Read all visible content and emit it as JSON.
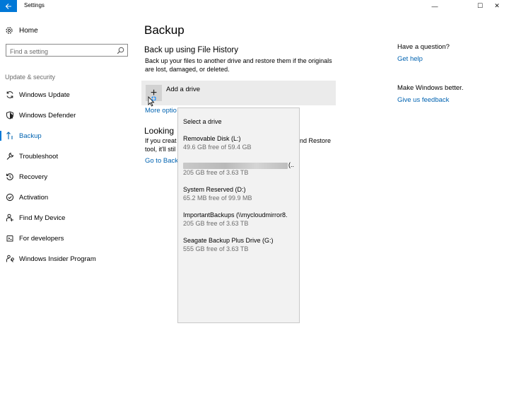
{
  "window": {
    "title": "Settings",
    "minimize_glyph": "—",
    "maximize_glyph": "☐",
    "close_glyph": "✕"
  },
  "sidebar": {
    "home_label": "Home",
    "search_placeholder": "Find a setting",
    "section_label": "Update & security",
    "items": [
      {
        "label": "Windows Update",
        "icon": "sync-icon"
      },
      {
        "label": "Windows Defender",
        "icon": "shield-icon"
      },
      {
        "label": "Backup",
        "icon": "backup-arrow-icon",
        "active": true
      },
      {
        "label": "Troubleshoot",
        "icon": "wrench-icon"
      },
      {
        "label": "Recovery",
        "icon": "history-icon"
      },
      {
        "label": "Activation",
        "icon": "check-circle-icon"
      },
      {
        "label": "Find My Device",
        "icon": "person-pin-icon"
      },
      {
        "label": "For developers",
        "icon": "developer-icon"
      },
      {
        "label": "Windows Insider Program",
        "icon": "insider-icon"
      }
    ]
  },
  "main": {
    "page_title": "Backup",
    "file_history": {
      "heading": "Back up using File History",
      "description": "Back up your files to another drive and restore them if the originals are lost, damaged, or deleted.",
      "add_drive_label": "Add a drive",
      "more_options": "More optio"
    },
    "looking": {
      "heading": "Looking",
      "line1": "If you creat",
      "line2": "tool, it'll stil",
      "line1_right": "nd Restore",
      "link": "Go to Backu"
    }
  },
  "right_panel": {
    "question_heading": "Have a question?",
    "get_help": "Get help",
    "better_heading": "Make Windows better.",
    "feedback": "Give us feedback"
  },
  "dropdown": {
    "title": "Select a drive",
    "drives": [
      {
        "name": "Removable Disk (L:)",
        "space": "49.6 GB free of 59.4 GB"
      },
      {
        "name": "",
        "name_obscured": true,
        "name_tail": "(..",
        "space": "205 GB free of 3.63 TB"
      },
      {
        "name": "System Reserved (D:)",
        "space": "65.2 MB free of 99.9 MB"
      },
      {
        "name": "ImportantBackups (\\\\mycloudmirror8.",
        "space": "205 GB free of 3.63 TB"
      },
      {
        "name": "Seagate Backup Plus Drive (G:)",
        "space": "555 GB free of 3.63 TB"
      }
    ]
  },
  "colors": {
    "accent": "#0078d7",
    "link": "#0063b1",
    "dropdown_bg": "#f2f2f2",
    "add_drive_bg": "#ebebeb"
  }
}
